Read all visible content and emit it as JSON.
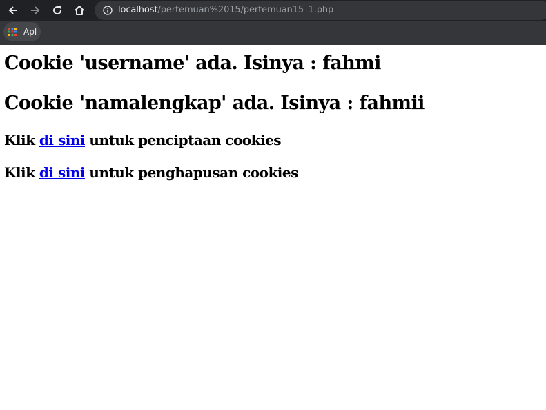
{
  "browser": {
    "nav": {
      "back_icon": "arrow-left-icon",
      "forward_icon": "arrow-right-icon",
      "reload_icon": "reload-icon",
      "home_icon": "home-icon"
    },
    "address_bar": {
      "host": "localhost",
      "path": "/pertemuan%2015/pertemuan15_1.php",
      "info_icon": "info-icon"
    },
    "bookmarks": {
      "apps_label": "Apl",
      "apps_icon": "apps-grid-icon"
    },
    "colors": {
      "toolbar": "#202124",
      "omnibox": "#35363a",
      "bookmarks_bar": "#35363a",
      "host_text": "#e8eaed",
      "path_text": "#9aa0a6"
    }
  },
  "page": {
    "cookie_username": "Cookie 'username' ada. Isinya : fahmi",
    "cookie_namalengkap": "Cookie 'namalengkap' ada. Isinya : fahmii",
    "create_line": {
      "prefix": "Klik ",
      "link": "di sini",
      "suffix": " untuk penciptaan cookies"
    },
    "delete_line": {
      "prefix": "Klik ",
      "link": "di sini",
      "suffix": " untuk penghapusan cookies"
    },
    "link_color": "#0000ee"
  }
}
